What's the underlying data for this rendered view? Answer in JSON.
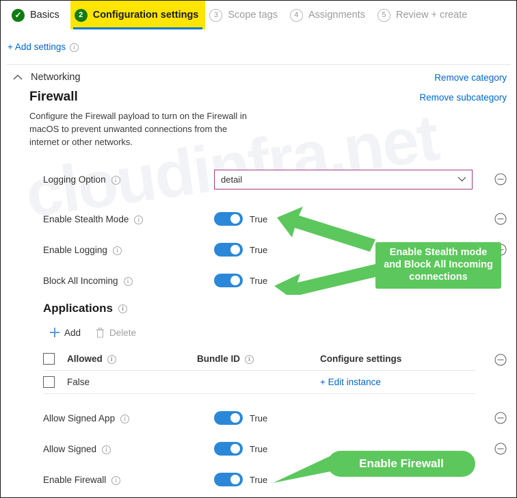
{
  "wizard": {
    "steps": [
      {
        "num": "✓",
        "label": "Basics",
        "state": "done"
      },
      {
        "num": "2",
        "label": "Configuration settings",
        "state": "active"
      },
      {
        "num": "3",
        "label": "Scope tags",
        "state": "future"
      },
      {
        "num": "4",
        "label": "Assignments",
        "state": "future"
      },
      {
        "num": "5",
        "label": "Review + create",
        "state": "future"
      }
    ]
  },
  "toolbar": {
    "add_settings_label": "+ Add settings"
  },
  "category": {
    "name": "Networking",
    "remove_category_label": "Remove category",
    "remove_subcategory_label": "Remove subcategory"
  },
  "subcategory": {
    "title": "Firewall",
    "description": "Configure the Firewall payload to turn on the Firewall in macOS to prevent unwanted connections from the internet or other networks."
  },
  "settings": {
    "logging_option": {
      "label": "Logging Option",
      "value": "detail"
    },
    "enable_stealth_mode": {
      "label": "Enable Stealth Mode",
      "value": "True"
    },
    "enable_logging": {
      "label": "Enable Logging",
      "value": "True"
    },
    "block_all_incoming": {
      "label": "Block All Incoming",
      "value": "True"
    },
    "allow_signed_app": {
      "label": "Allow Signed App",
      "value": "True"
    },
    "allow_signed": {
      "label": "Allow Signed",
      "value": "True"
    },
    "enable_firewall": {
      "label": "Enable Firewall",
      "value": "True"
    }
  },
  "applications": {
    "title": "Applications",
    "add_label": "Add",
    "delete_label": "Delete",
    "columns": [
      "Allowed",
      "Bundle ID",
      "Configure settings"
    ],
    "rows": [
      {
        "allowed": "False",
        "bundle_id": "",
        "configure": "+ Edit instance"
      }
    ]
  },
  "annotations": {
    "stealth_note": "Enable Stealth mode and Block All Incoming connections",
    "firewall_note": "Enable Firewall"
  },
  "watermark": {
    "text": "cloudinfra.net"
  },
  "colors": {
    "accent_blue": "#0078d4",
    "link_blue": "#0066cc",
    "highlight_yellow": "#ffe500",
    "step_green": "#107c10",
    "annotation_green": "#5cc75c",
    "dropdown_border_purple": "#a4368c",
    "toggle_on_blue": "#2b88d8"
  }
}
